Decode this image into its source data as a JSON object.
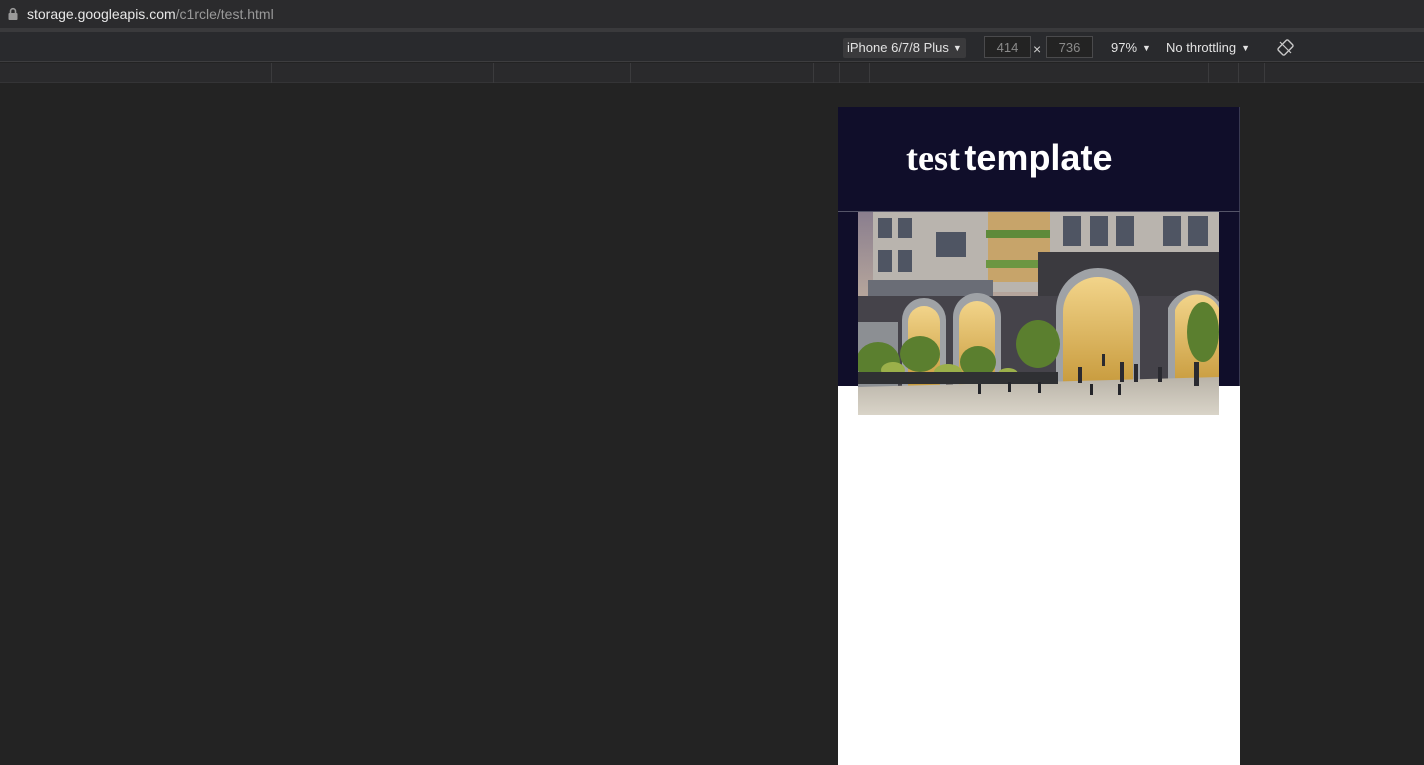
{
  "address_bar": {
    "host": "storage.googleapis.com",
    "path": "/c1rcle/test.html"
  },
  "device_toolbar": {
    "device": "iPhone 6/7/8 Plus",
    "width": "414",
    "height": "736",
    "separator": "×",
    "zoom": "97%",
    "throttling": "No throttling",
    "caret": "▼"
  },
  "page": {
    "title_part1": "test",
    "title_part2": "template",
    "hero_bg_color": "#100e2a",
    "body_bg_color": "#ffffff"
  }
}
